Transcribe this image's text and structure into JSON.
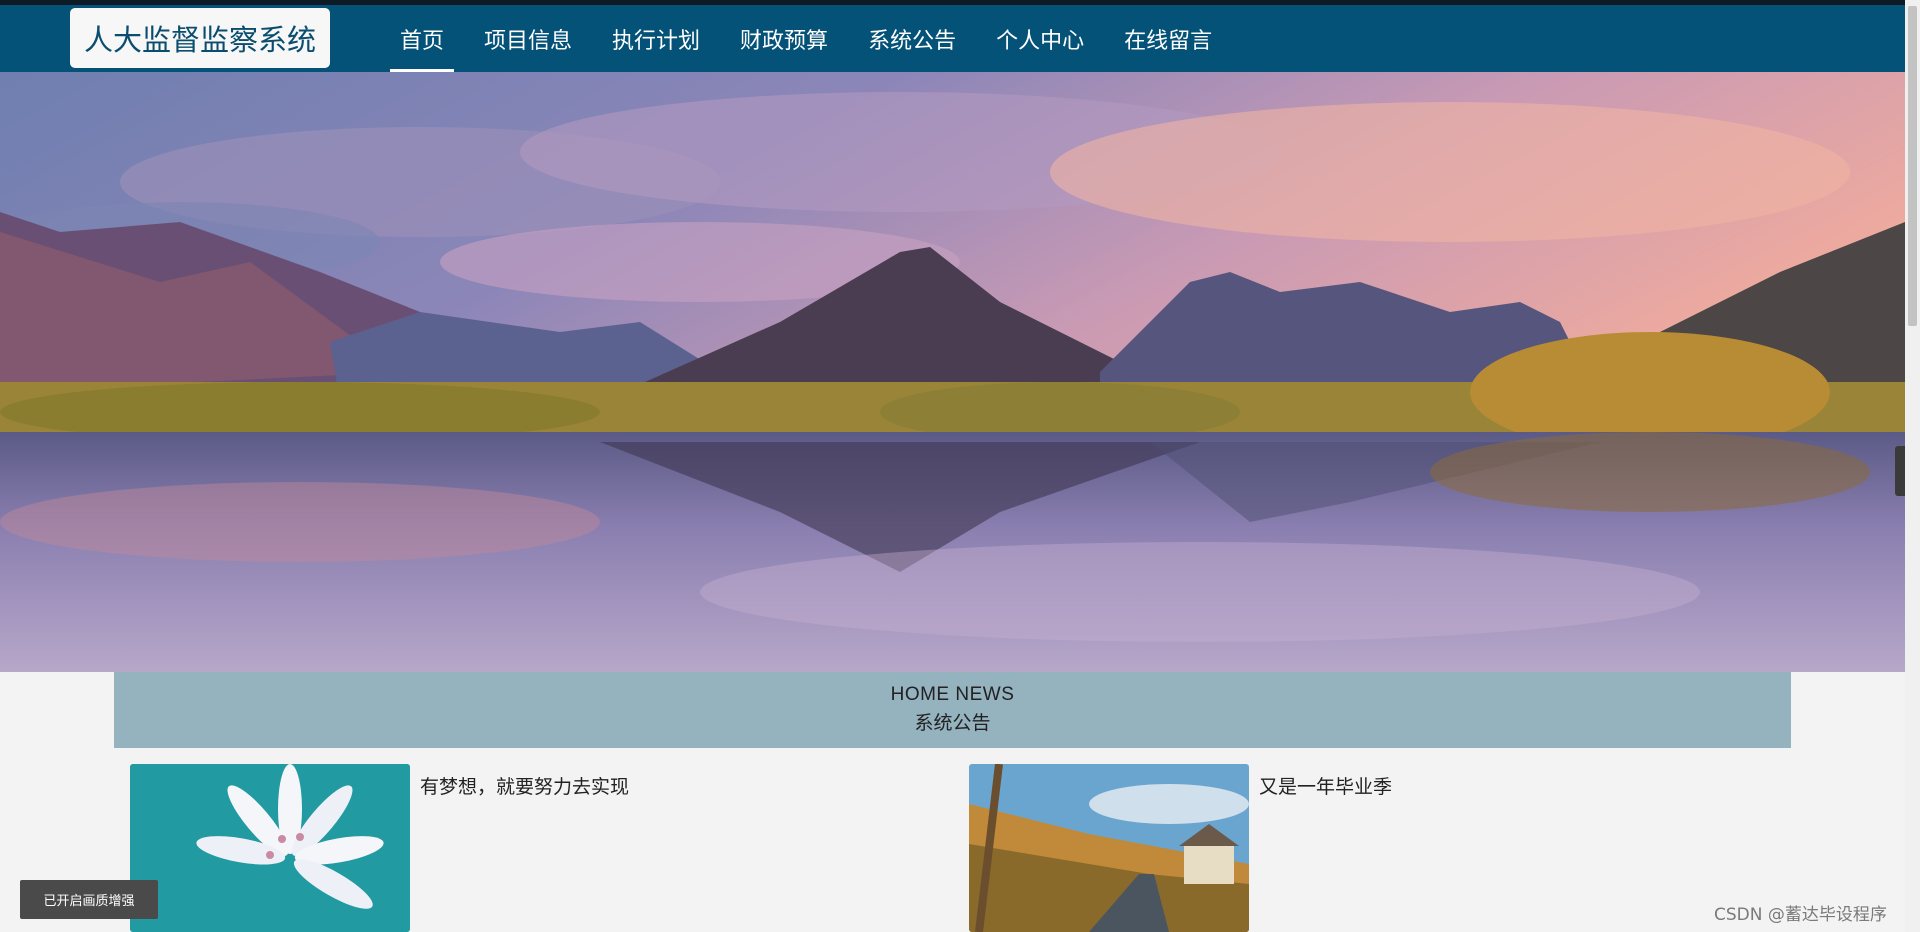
{
  "header": {
    "logo": "人大监督监察系统",
    "menu": [
      {
        "label": "首页",
        "active": true
      },
      {
        "label": "项目信息",
        "active": false
      },
      {
        "label": "执行计划",
        "active": false
      },
      {
        "label": "财政预算",
        "active": false
      },
      {
        "label": "系统公告",
        "active": false
      },
      {
        "label": "个人中心",
        "active": false
      },
      {
        "label": "在线留言",
        "active": false
      }
    ]
  },
  "banner": {
    "image": "mountain-lake-landscape",
    "slides": 3,
    "active_slide": 1
  },
  "side_tab": {
    "icon": "chevron-left-icon",
    "glyph": "‹"
  },
  "news": {
    "title_en": "HOME NEWS",
    "title_cn": "系统公告",
    "items": [
      {
        "title": "有梦想，就要努力去实现",
        "image": "white-flower-photo"
      },
      {
        "title": "又是一年毕业季",
        "image": "country-road-house-photo"
      }
    ]
  },
  "toast": "已开启画质增强",
  "watermark": "CSDN @蓄达毕设程序",
  "colors": {
    "navbar": "#045277",
    "news_header": "#95b2bf",
    "background": "#f3f3f4"
  }
}
